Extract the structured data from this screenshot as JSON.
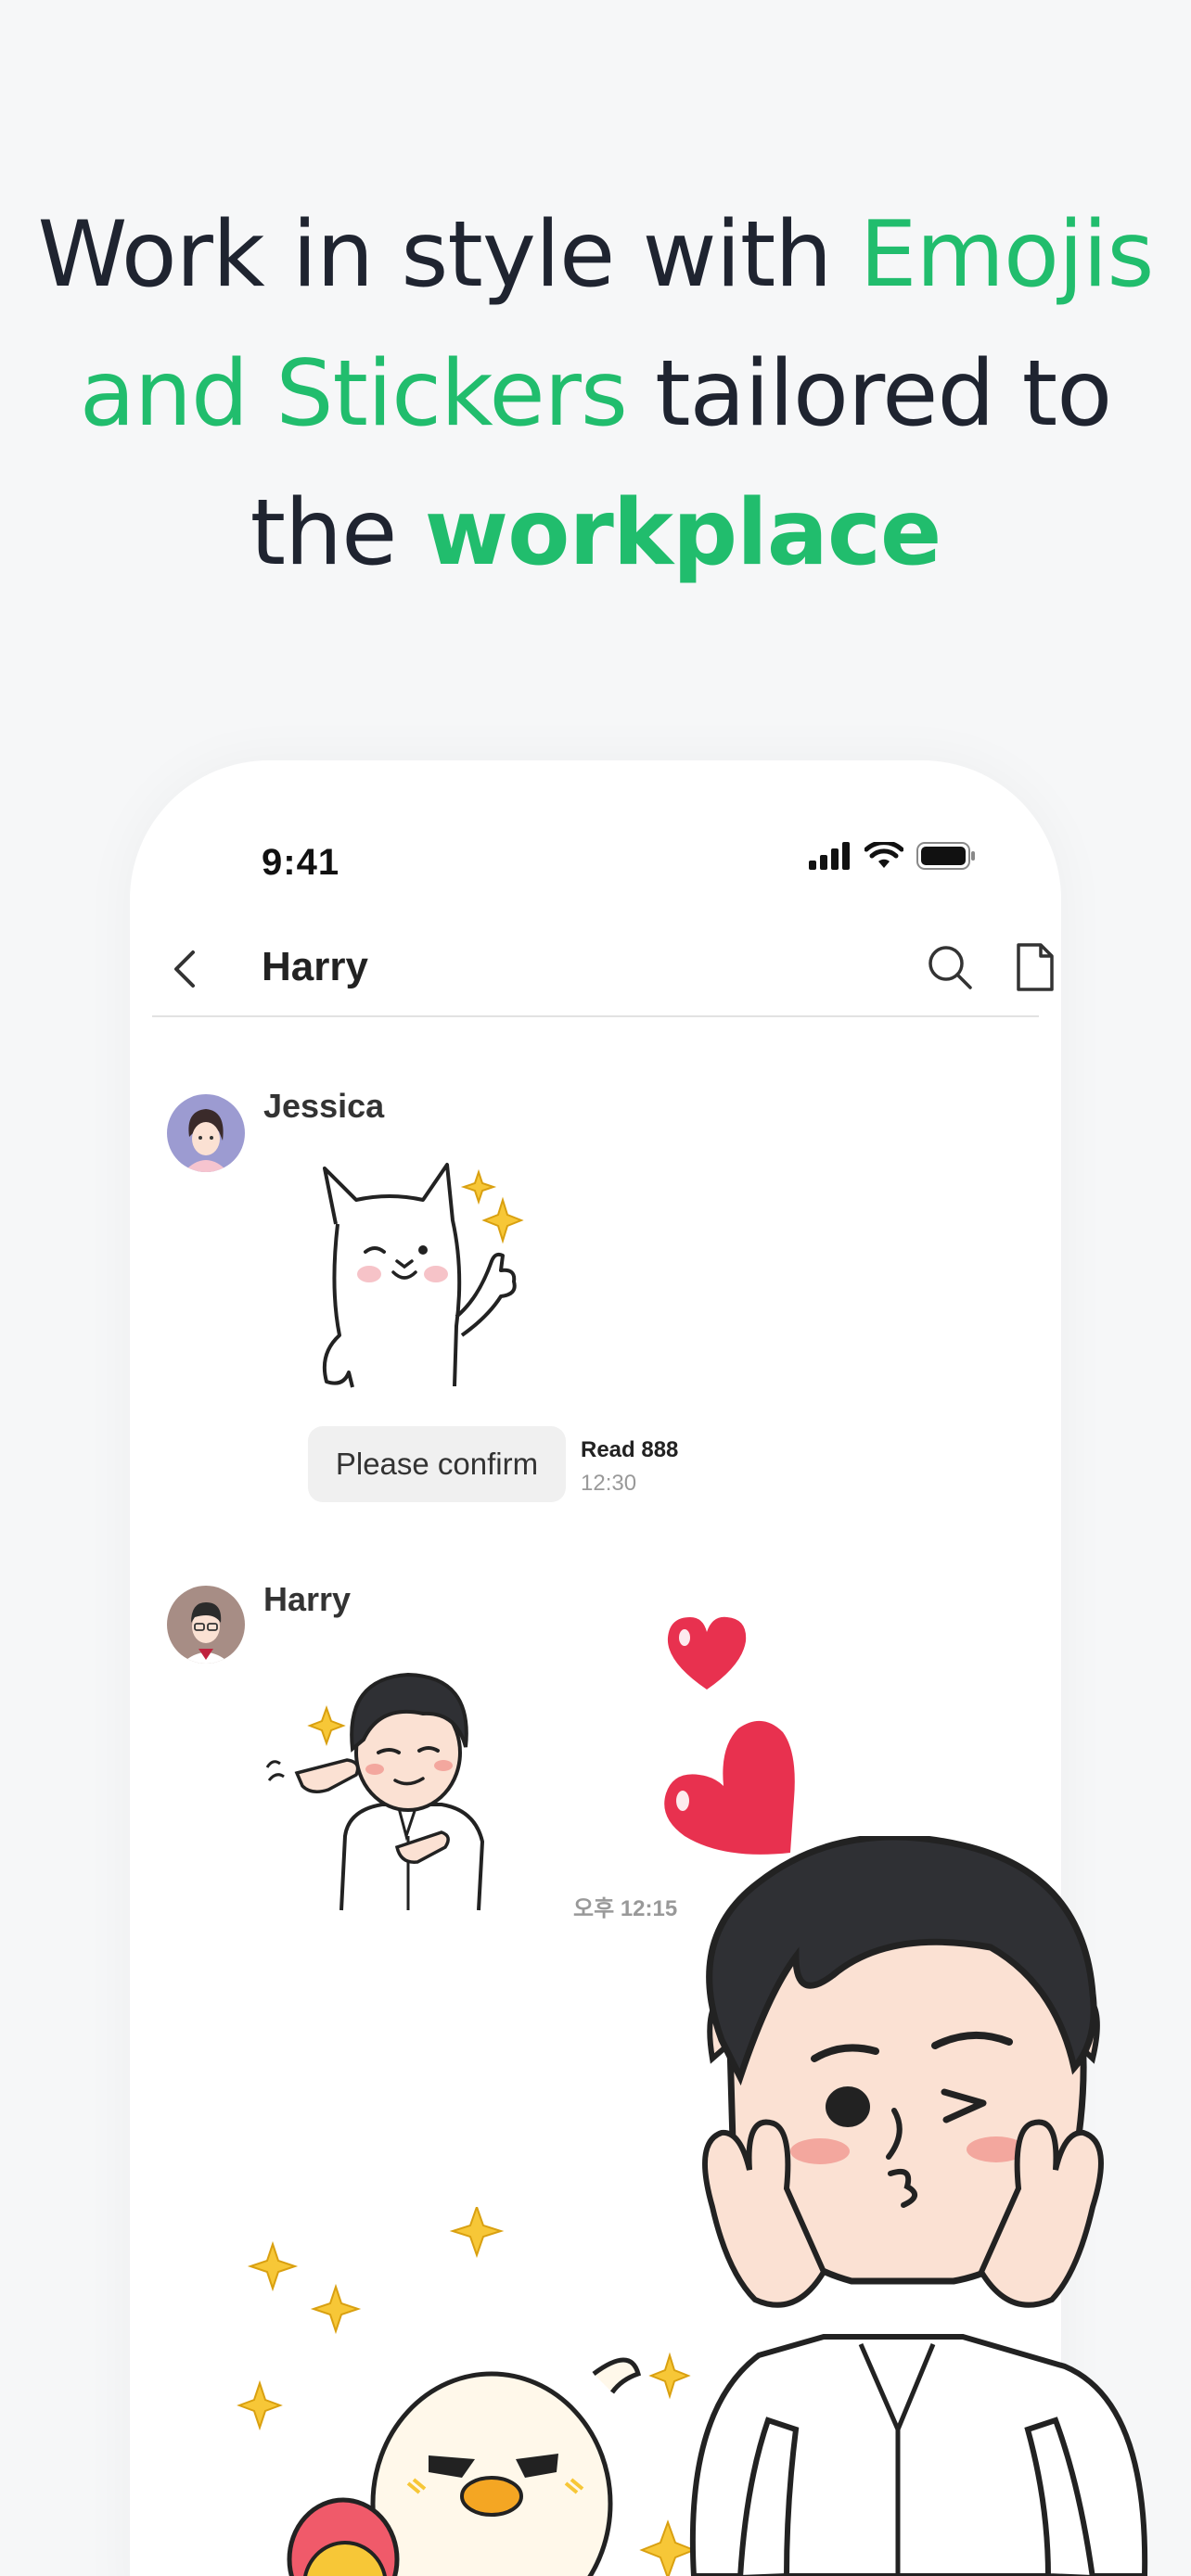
{
  "headline": {
    "part1": "Work in style with ",
    "part2": "Emojis and Stickers",
    "part3": " tailored to the ",
    "part4": "workplace"
  },
  "status_bar": {
    "time": "9:41",
    "icons": [
      "signal-icon",
      "wifi-icon",
      "battery-icon"
    ]
  },
  "header": {
    "title": "Harry",
    "icons": [
      "back-icon",
      "search-icon",
      "file-icon",
      "menu-icon"
    ]
  },
  "messages": [
    {
      "sender": "Jessica",
      "sticker": "cat-thumbs-up-sticker",
      "text": "Please confirm",
      "read_label": "Read 888",
      "time": "12:30"
    },
    {
      "sender": "Harry",
      "sticker": "man-finger-guns-sticker",
      "time": "오후 12:15"
    }
  ],
  "colors": {
    "accent": "#21bd6d",
    "text_dark": "#1f2430",
    "heart": "#e8314f"
  }
}
